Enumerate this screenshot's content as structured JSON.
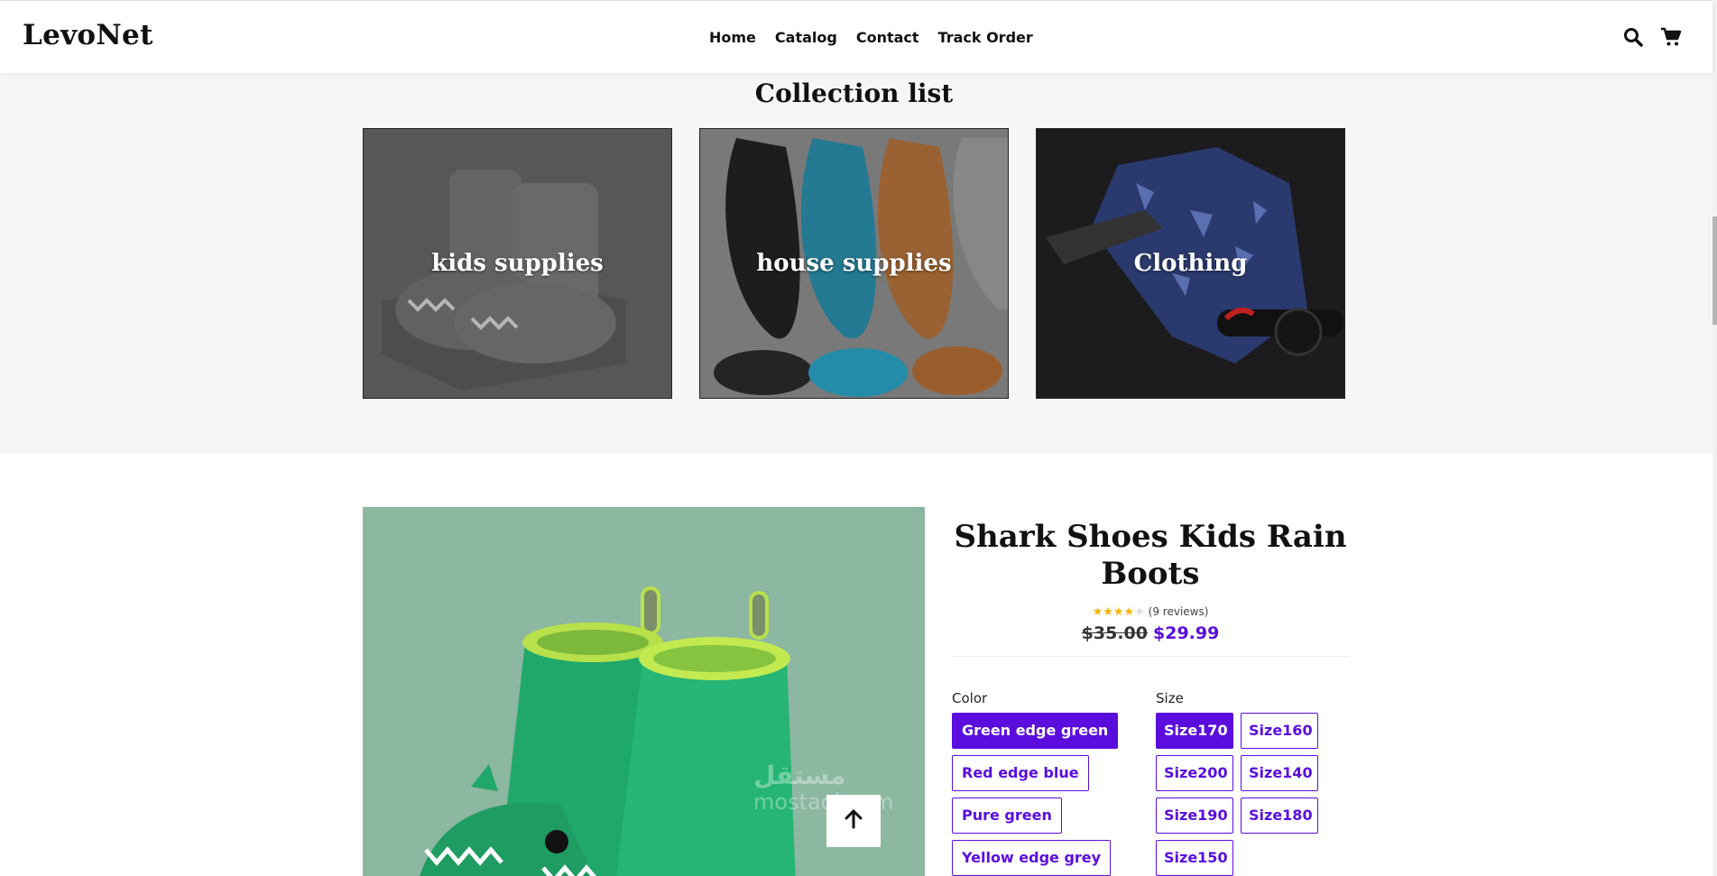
{
  "header": {
    "logo": "LevoNet",
    "nav": [
      "Home",
      "Catalog",
      "Contact",
      "Track Order"
    ],
    "icons": [
      "search-icon",
      "cart-icon"
    ]
  },
  "collection": {
    "title": "Collection list",
    "cards": [
      {
        "label": "kids supplies"
      },
      {
        "label": "house supplies"
      },
      {
        "label": "Clothing"
      }
    ]
  },
  "product": {
    "title": "Shark Shoes Kids Rain Boots",
    "rating_value": 4,
    "rating_max": 5,
    "reviews": "(9 reviews)",
    "old_price": "$35.00",
    "new_price": "$29.99",
    "color_label": "Color",
    "colors": [
      "Green edge green",
      "Red edge blue",
      "Pure green",
      "Yellow edge grey"
    ],
    "selected_color": "Green edge green",
    "size_label": "Size",
    "sizes": [
      "Size170",
      "Size160",
      "Size200",
      "Size140",
      "Size190",
      "Size180",
      "Size150"
    ],
    "selected_size": "Size170"
  },
  "watermark": {
    "arabic": "مستقل",
    "latin": "mostaql.com"
  },
  "colors": {
    "accent": "#5a0ddd",
    "section_bg": "#f6f6f6",
    "product_bg": "#8cb7a1"
  }
}
